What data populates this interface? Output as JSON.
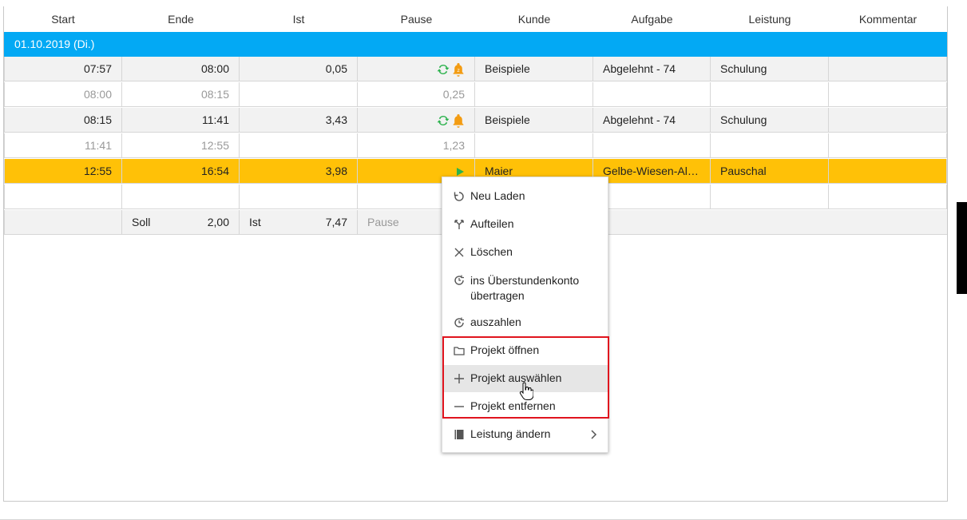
{
  "columns": [
    "Start",
    "Ende",
    "Ist",
    "Pause",
    "Kunde",
    "Aufgabe",
    "Leistung",
    "Kommentar"
  ],
  "date_header": "01.10.2019 (Di.)",
  "rows": [
    {
      "start": "07:57",
      "ende": "08:00",
      "ist": "0,05",
      "pause": "",
      "kunde": "Beispiele",
      "aufgabe": "Abgelehnt - 74",
      "leistung": "Schulung",
      "kommentar": ""
    },
    {
      "start": "08:00",
      "ende": "08:15",
      "ist": "",
      "pause": "0,25",
      "kunde": "",
      "aufgabe": "",
      "leistung": "",
      "kommentar": ""
    },
    {
      "start": "08:15",
      "ende": "11:41",
      "ist": "3,43",
      "pause": "",
      "kunde": "Beispiele",
      "aufgabe": "Abgelehnt - 74",
      "leistung": "Schulung",
      "kommentar": ""
    },
    {
      "start": "11:41",
      "ende": "12:55",
      "ist": "",
      "pause": "1,23",
      "kunde": "",
      "aufgabe": "",
      "leistung": "",
      "kommentar": ""
    },
    {
      "start": "12:55",
      "ende": "16:54",
      "ist": "3,98",
      "pause": "",
      "kunde": "Maier",
      "aufgabe": "Gelbe-Wiesen-Allee",
      "leistung": "Pauschal",
      "kommentar": ""
    }
  ],
  "summary": {
    "soll_label": "Soll",
    "soll_value": "2,00",
    "ist_label": "Ist",
    "ist_value": "7,47",
    "pause_label": "Pause"
  },
  "context_menu": {
    "items": [
      {
        "label": "Neu Laden",
        "icon": "reload-icon"
      },
      {
        "label": "Aufteilen",
        "icon": "split-icon"
      },
      {
        "label": "Löschen",
        "icon": "close-icon"
      },
      {
        "label": "ins Überstundenkonto übertragen",
        "icon": "clock-refresh-icon"
      },
      {
        "label": "auszahlen",
        "icon": "clock-refresh-icon"
      },
      {
        "label": "Projekt öffnen",
        "icon": "folder-icon"
      },
      {
        "label": "Projekt auswählen",
        "icon": "plus-icon"
      },
      {
        "label": "Projekt entfernen",
        "icon": "minus-icon"
      },
      {
        "label": "Leistung ändern",
        "icon": "book-icon"
      }
    ]
  },
  "colors": {
    "date_header_bg": "#03a9f4",
    "active_row_bg": "#ffc107",
    "highlight_border": "#e0141e",
    "sync_icon": "#2bb24c",
    "bell_icon": "#f39c12",
    "play_icon": "#2bb24c"
  }
}
